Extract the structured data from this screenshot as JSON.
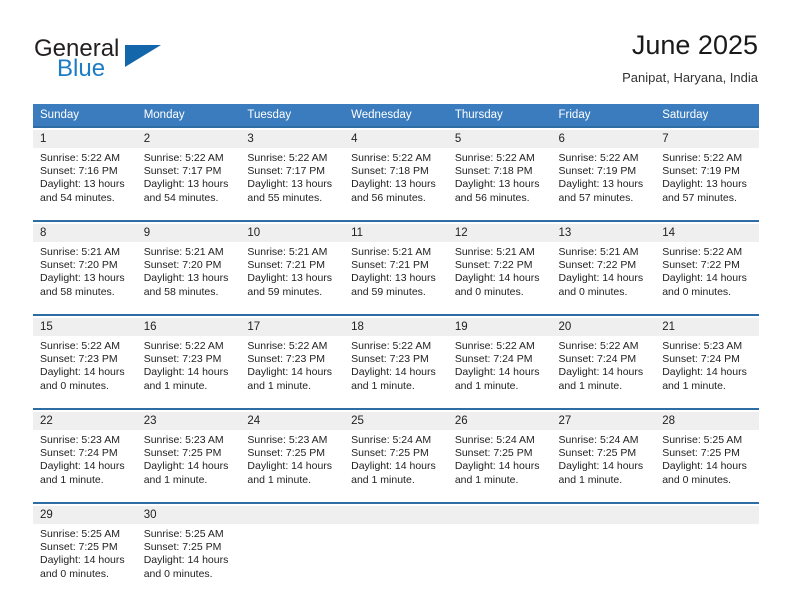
{
  "brand": {
    "word1": "General",
    "word2": "Blue",
    "triangle_color": "#1466aa",
    "blue_color": "#1c7cc4"
  },
  "header": {
    "title": "June 2025",
    "subtitle": "Panipat, Haryana, India"
  },
  "theme": {
    "header_row_bg": "#3a7cbe",
    "week_rule": "#2e6da4",
    "daynum_bg": "#efefef"
  },
  "weekday_headers": [
    "Sunday",
    "Monday",
    "Tuesday",
    "Wednesday",
    "Thursday",
    "Friday",
    "Saturday"
  ],
  "weeks": [
    {
      "days": [
        {
          "num": "1",
          "sunrise": "Sunrise: 5:22 AM",
          "sunset": "Sunset: 7:16 PM",
          "daylight1": "Daylight: 13 hours",
          "daylight2": "and 54 minutes."
        },
        {
          "num": "2",
          "sunrise": "Sunrise: 5:22 AM",
          "sunset": "Sunset: 7:17 PM",
          "daylight1": "Daylight: 13 hours",
          "daylight2": "and 54 minutes."
        },
        {
          "num": "3",
          "sunrise": "Sunrise: 5:22 AM",
          "sunset": "Sunset: 7:17 PM",
          "daylight1": "Daylight: 13 hours",
          "daylight2": "and 55 minutes."
        },
        {
          "num": "4",
          "sunrise": "Sunrise: 5:22 AM",
          "sunset": "Sunset: 7:18 PM",
          "daylight1": "Daylight: 13 hours",
          "daylight2": "and 56 minutes."
        },
        {
          "num": "5",
          "sunrise": "Sunrise: 5:22 AM",
          "sunset": "Sunset: 7:18 PM",
          "daylight1": "Daylight: 13 hours",
          "daylight2": "and 56 minutes."
        },
        {
          "num": "6",
          "sunrise": "Sunrise: 5:22 AM",
          "sunset": "Sunset: 7:19 PM",
          "daylight1": "Daylight: 13 hours",
          "daylight2": "and 57 minutes."
        },
        {
          "num": "7",
          "sunrise": "Sunrise: 5:22 AM",
          "sunset": "Sunset: 7:19 PM",
          "daylight1": "Daylight: 13 hours",
          "daylight2": "and 57 minutes."
        }
      ]
    },
    {
      "days": [
        {
          "num": "8",
          "sunrise": "Sunrise: 5:21 AM",
          "sunset": "Sunset: 7:20 PM",
          "daylight1": "Daylight: 13 hours",
          "daylight2": "and 58 minutes."
        },
        {
          "num": "9",
          "sunrise": "Sunrise: 5:21 AM",
          "sunset": "Sunset: 7:20 PM",
          "daylight1": "Daylight: 13 hours",
          "daylight2": "and 58 minutes."
        },
        {
          "num": "10",
          "sunrise": "Sunrise: 5:21 AM",
          "sunset": "Sunset: 7:21 PM",
          "daylight1": "Daylight: 13 hours",
          "daylight2": "and 59 minutes."
        },
        {
          "num": "11",
          "sunrise": "Sunrise: 5:21 AM",
          "sunset": "Sunset: 7:21 PM",
          "daylight1": "Daylight: 13 hours",
          "daylight2": "and 59 minutes."
        },
        {
          "num": "12",
          "sunrise": "Sunrise: 5:21 AM",
          "sunset": "Sunset: 7:22 PM",
          "daylight1": "Daylight: 14 hours",
          "daylight2": "and 0 minutes."
        },
        {
          "num": "13",
          "sunrise": "Sunrise: 5:21 AM",
          "sunset": "Sunset: 7:22 PM",
          "daylight1": "Daylight: 14 hours",
          "daylight2": "and 0 minutes."
        },
        {
          "num": "14",
          "sunrise": "Sunrise: 5:22 AM",
          "sunset": "Sunset: 7:22 PM",
          "daylight1": "Daylight: 14 hours",
          "daylight2": "and 0 minutes."
        }
      ]
    },
    {
      "days": [
        {
          "num": "15",
          "sunrise": "Sunrise: 5:22 AM",
          "sunset": "Sunset: 7:23 PM",
          "daylight1": "Daylight: 14 hours",
          "daylight2": "and 0 minutes."
        },
        {
          "num": "16",
          "sunrise": "Sunrise: 5:22 AM",
          "sunset": "Sunset: 7:23 PM",
          "daylight1": "Daylight: 14 hours",
          "daylight2": "and 1 minute."
        },
        {
          "num": "17",
          "sunrise": "Sunrise: 5:22 AM",
          "sunset": "Sunset: 7:23 PM",
          "daylight1": "Daylight: 14 hours",
          "daylight2": "and 1 minute."
        },
        {
          "num": "18",
          "sunrise": "Sunrise: 5:22 AM",
          "sunset": "Sunset: 7:23 PM",
          "daylight1": "Daylight: 14 hours",
          "daylight2": "and 1 minute."
        },
        {
          "num": "19",
          "sunrise": "Sunrise: 5:22 AM",
          "sunset": "Sunset: 7:24 PM",
          "daylight1": "Daylight: 14 hours",
          "daylight2": "and 1 minute."
        },
        {
          "num": "20",
          "sunrise": "Sunrise: 5:22 AM",
          "sunset": "Sunset: 7:24 PM",
          "daylight1": "Daylight: 14 hours",
          "daylight2": "and 1 minute."
        },
        {
          "num": "21",
          "sunrise": "Sunrise: 5:23 AM",
          "sunset": "Sunset: 7:24 PM",
          "daylight1": "Daylight: 14 hours",
          "daylight2": "and 1 minute."
        }
      ]
    },
    {
      "days": [
        {
          "num": "22",
          "sunrise": "Sunrise: 5:23 AM",
          "sunset": "Sunset: 7:24 PM",
          "daylight1": "Daylight: 14 hours",
          "daylight2": "and 1 minute."
        },
        {
          "num": "23",
          "sunrise": "Sunrise: 5:23 AM",
          "sunset": "Sunset: 7:25 PM",
          "daylight1": "Daylight: 14 hours",
          "daylight2": "and 1 minute."
        },
        {
          "num": "24",
          "sunrise": "Sunrise: 5:23 AM",
          "sunset": "Sunset: 7:25 PM",
          "daylight1": "Daylight: 14 hours",
          "daylight2": "and 1 minute."
        },
        {
          "num": "25",
          "sunrise": "Sunrise: 5:24 AM",
          "sunset": "Sunset: 7:25 PM",
          "daylight1": "Daylight: 14 hours",
          "daylight2": "and 1 minute."
        },
        {
          "num": "26",
          "sunrise": "Sunrise: 5:24 AM",
          "sunset": "Sunset: 7:25 PM",
          "daylight1": "Daylight: 14 hours",
          "daylight2": "and 1 minute."
        },
        {
          "num": "27",
          "sunrise": "Sunrise: 5:24 AM",
          "sunset": "Sunset: 7:25 PM",
          "daylight1": "Daylight: 14 hours",
          "daylight2": "and 1 minute."
        },
        {
          "num": "28",
          "sunrise": "Sunrise: 5:25 AM",
          "sunset": "Sunset: 7:25 PM",
          "daylight1": "Daylight: 14 hours",
          "daylight2": "and 0 minutes."
        }
      ]
    },
    {
      "days": [
        {
          "num": "29",
          "sunrise": "Sunrise: 5:25 AM",
          "sunset": "Sunset: 7:25 PM",
          "daylight1": "Daylight: 14 hours",
          "daylight2": "and 0 minutes."
        },
        {
          "num": "30",
          "sunrise": "Sunrise: 5:25 AM",
          "sunset": "Sunset: 7:25 PM",
          "daylight1": "Daylight: 14 hours",
          "daylight2": "and 0 minutes."
        },
        {
          "num": "",
          "sunrise": "",
          "sunset": "",
          "daylight1": "",
          "daylight2": ""
        },
        {
          "num": "",
          "sunrise": "",
          "sunset": "",
          "daylight1": "",
          "daylight2": ""
        },
        {
          "num": "",
          "sunrise": "",
          "sunset": "",
          "daylight1": "",
          "daylight2": ""
        },
        {
          "num": "",
          "sunrise": "",
          "sunset": "",
          "daylight1": "",
          "daylight2": ""
        },
        {
          "num": "",
          "sunrise": "",
          "sunset": "",
          "daylight1": "",
          "daylight2": ""
        }
      ]
    }
  ]
}
